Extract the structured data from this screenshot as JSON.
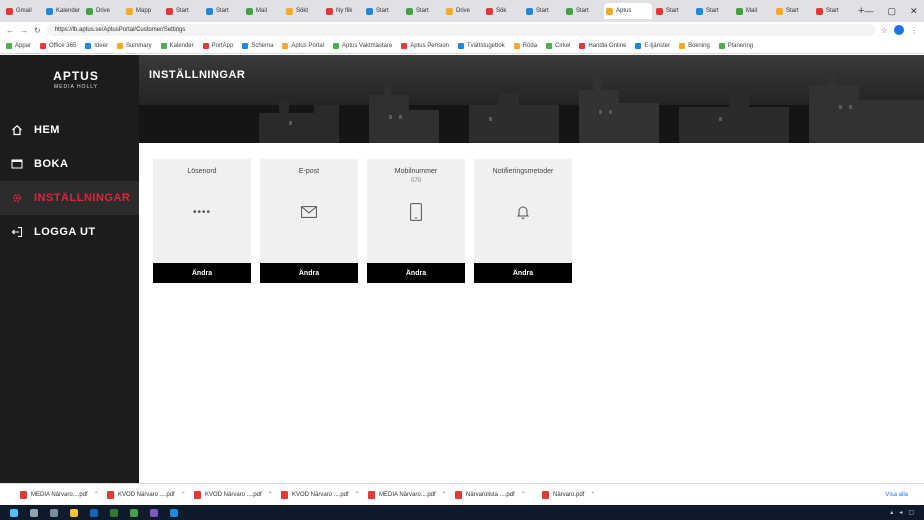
{
  "browser": {
    "tabs": [
      "Gmail",
      "Kalender",
      "Drive",
      "Mapp",
      "Start",
      "Start",
      "Mail",
      "Sökt",
      "Ny flik",
      "Start",
      "Start",
      "Drive",
      "Sök",
      "Start",
      "Start",
      "Aptus",
      "Start",
      "Start",
      "Mail",
      "Start",
      "Start"
    ],
    "active_tab_label": "Aptus",
    "url": "https://lb.aptus.se/AptusPortal/Customer/Settings",
    "bookmarks": [
      "Appar",
      "Office 365",
      "Ideer",
      "Summary",
      "Kalender",
      "PortApp",
      "Schema",
      "Aptus Portal",
      "Aptus Vaktmästare",
      "Aptus Pension",
      "Tvättstugebok",
      "Röda",
      "Cirkel",
      "Handla Online",
      "E-tjänster",
      "Bokning",
      "Planering"
    ]
  },
  "app": {
    "logo": {
      "main": "APTUS",
      "sub": "MEDIA HOLLY"
    },
    "menu": [
      {
        "label": "HEM",
        "icon": "home-icon"
      },
      {
        "label": "BOKA",
        "icon": "calendar-icon"
      },
      {
        "label": "INSTÄLLNINGAR",
        "icon": "gear-icon",
        "active": true
      },
      {
        "label": "LOGGA UT",
        "icon": "logout-icon"
      }
    ],
    "page_title": "INSTÄLLNINGAR",
    "accent_color": "#e0243a",
    "cards": [
      {
        "title": "Lösenord",
        "value": "",
        "display": "••••",
        "icon": "password-dots-icon",
        "button": "Ändra"
      },
      {
        "title": "E-post",
        "value": "",
        "icon": "mail-icon",
        "button": "Ändra"
      },
      {
        "title": "Mobilnummer",
        "value": "070",
        "icon": "phone-icon",
        "button": "Ändra"
      },
      {
        "title": "Notifieringsmetoder",
        "value": "",
        "icon": "bell-icon",
        "button": "Ändra"
      }
    ]
  },
  "downloads": {
    "files": [
      "MEDIA Närvaro....pdf",
      "KVOD Närvaro ....pdf",
      "KVOD Närvaro ....pdf",
      "KVOD Närvaro ....pdf",
      "MEDIA Närvaro....pdf",
      "Närvarolista ....pdf",
      "Närvaro.pdf"
    ],
    "show_all": "Visa alla"
  }
}
